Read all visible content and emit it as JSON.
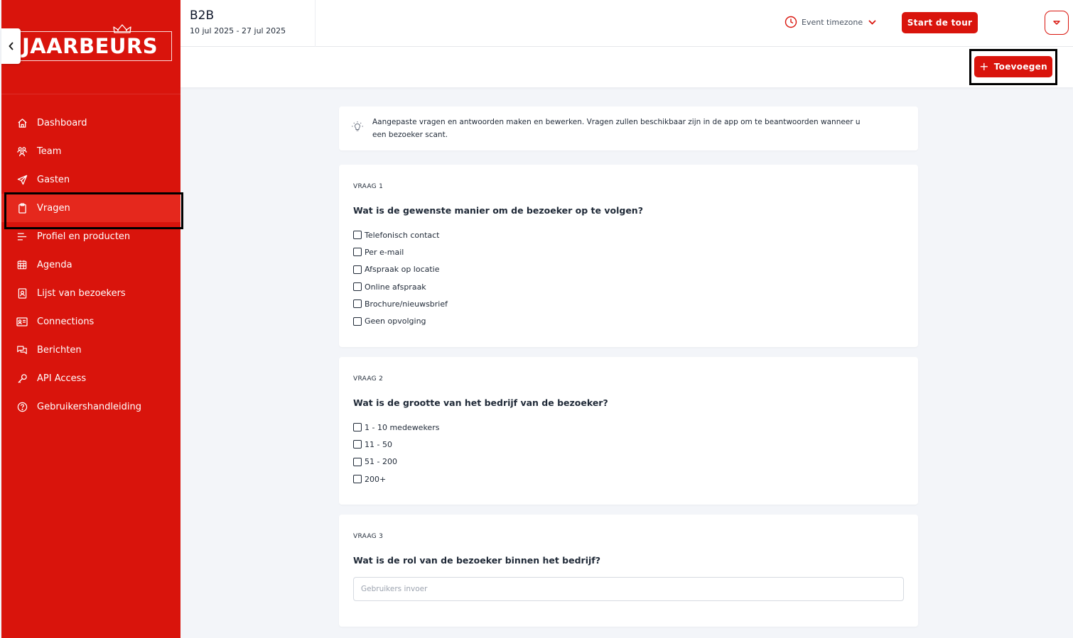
{
  "brand": {
    "logo_text": "JAARBEURS",
    "primary_color": "#d9140c"
  },
  "sidebar": {
    "collapse_icon": "chevron-left-icon",
    "items": [
      {
        "label": "Dashboard",
        "icon": "home-icon"
      },
      {
        "label": "Team",
        "icon": "users-icon"
      },
      {
        "label": "Gasten",
        "icon": "send-icon"
      },
      {
        "label": "Vragen",
        "icon": "clipboard-icon",
        "active": true
      },
      {
        "label": "Profiel en producten",
        "icon": "list-icon"
      },
      {
        "label": "Agenda",
        "icon": "calendar-icon"
      },
      {
        "label": "Lijst van bezoekers",
        "icon": "contact-list-icon"
      },
      {
        "label": "Connections",
        "icon": "id-card-icon"
      },
      {
        "label": "Berichten",
        "icon": "chat-icon"
      },
      {
        "label": "API Access",
        "icon": "key-icon"
      },
      {
        "label": "Gebruikershandleiding",
        "icon": "help-circle-icon"
      }
    ]
  },
  "header": {
    "event_title": "B2B",
    "event_dates": "10 jul 2025 - 27 jul 2025",
    "timezone_label": "Event timezone",
    "tour_button": "Start de tour"
  },
  "toolbar": {
    "add_button": "Toevoegen"
  },
  "info": {
    "text": "Aangepaste vragen en antwoorden maken en bewerken. Vragen zullen beschikbaar zijn in de app om te beantwoorden wanneer u een bezoeker scant."
  },
  "questions": [
    {
      "number_label": "VRAAG 1",
      "title": "Wat is de gewenste manier om de bezoeker op te volgen?",
      "options": [
        "Telefonisch contact",
        "Per e-mail",
        "Afspraak op locatie",
        "Online afspraak",
        "Brochure/nieuwsbrief",
        "Geen opvolging"
      ]
    },
    {
      "number_label": "VRAAG 2",
      "title": "Wat is de grootte van het bedrijf van de bezoeker?",
      "options": [
        "1 - 10 medewekers",
        "11 - 50",
        "51 - 200",
        "200+"
      ]
    },
    {
      "number_label": "VRAAG 3",
      "title": "Wat is de rol van de bezoeker binnen het bedrijf?",
      "input_placeholder": "Gebruikers invoer"
    }
  ]
}
